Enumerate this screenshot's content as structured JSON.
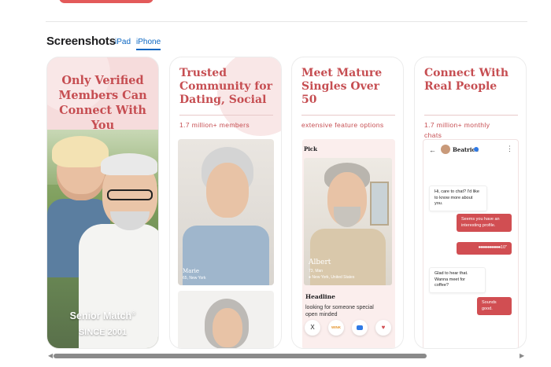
{
  "section": {
    "title": "Screenshots",
    "tabs": [
      {
        "label": "iPad",
        "selected": false
      },
      {
        "label": "iPhone",
        "selected": true
      }
    ]
  },
  "cards": [
    {
      "headline_lines": [
        "Only Verified",
        "Members Can",
        "Connect With You"
      ],
      "brand": "Senior Match",
      "brand_mark": "®",
      "since": "SINCE 2001"
    },
    {
      "headline_lines": [
        "Trusted",
        "Community for",
        "Dating, Social"
      ],
      "subtitle": "1.7 million+ members",
      "profile_name": "Marie",
      "profile_location": "65, New York"
    },
    {
      "headline_lines": [
        "Meet Mature",
        "Singles Over 50"
      ],
      "subtitle": "extensive feature options",
      "pick_label": "Pick",
      "profile_name": "Albert",
      "profile_age": "73, Man",
      "profile_location": "New York, United States",
      "headline_label": "Headline",
      "bio": "looking for someone special open minded",
      "actions": [
        "X",
        "WINK",
        "",
        "♥"
      ]
    },
    {
      "headline_lines": [
        "Connect With",
        "Real People"
      ],
      "subtitle_lines": [
        "1.7 million+ monthly",
        "chats"
      ],
      "chat": {
        "contact": "Beatrice",
        "messages": [
          {
            "from": "in",
            "text": "Hi, care to chat? I'd like to know more about you."
          },
          {
            "from": "out",
            "text": "Seems you have an interesting profile."
          },
          {
            "from": "out",
            "text": "10\""
          },
          {
            "from": "in",
            "text": "Glad to hear that. Wanna meet for coffee?"
          },
          {
            "from": "out",
            "text": "Sounds good."
          }
        ]
      }
    }
  ],
  "colors": {
    "accent_red": "#c64e52",
    "tab_blue": "#0a66c2",
    "card_pink": "#f6dcdc"
  }
}
